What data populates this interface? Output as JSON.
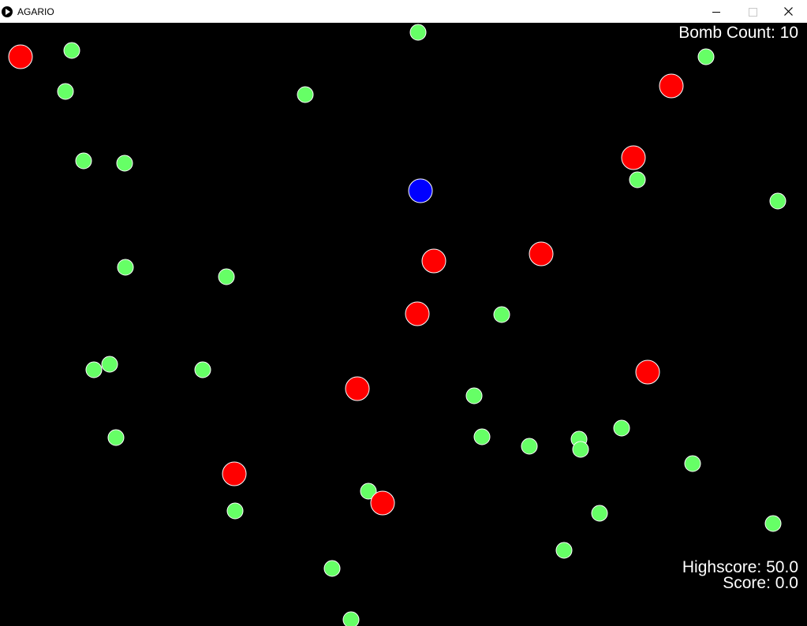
{
  "window": {
    "title": "AGARIO"
  },
  "hud": {
    "bomb_count_label": "Bomb Count:",
    "bomb_count": "10",
    "highscore_label": "Highscore:",
    "highscore": "50.0",
    "score_label": "Score:",
    "score": "0.0"
  },
  "colors": {
    "background": "#000000",
    "food": "#66ff66",
    "bomb": "#ff0000",
    "player": "#0000ff",
    "outline": "#ffffff"
  }
}
